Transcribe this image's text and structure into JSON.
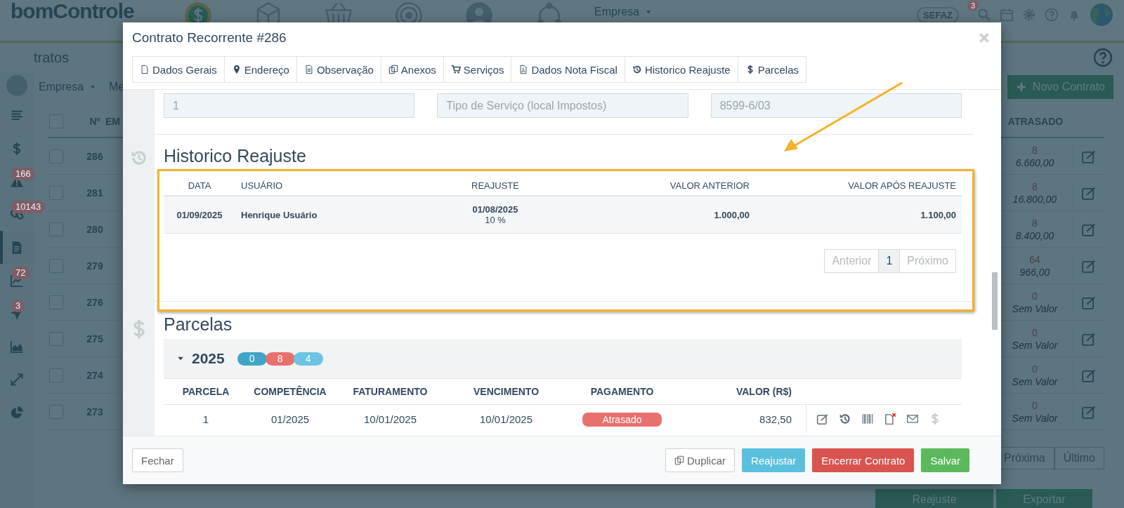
{
  "header": {
    "logo": "bomControle",
    "company_menu": "Empresa",
    "sefaz_logo": "SEFAZ",
    "notification_count": "3"
  },
  "page": {
    "title": "tratos",
    "filters": [
      "Empresa",
      "Me"
    ],
    "new_button": "Novo Contrato"
  },
  "sidebar": {
    "items": [
      {
        "kind": "menu",
        "selected": false
      },
      {
        "kind": "money",
        "selected": false
      },
      {
        "kind": "alert",
        "badge": "166",
        "selected": false
      },
      {
        "kind": "link",
        "badge": "10143",
        "selected": false
      },
      {
        "kind": "document",
        "selected": true
      },
      {
        "kind": "chart",
        "badge": "72",
        "selected": false
      },
      {
        "kind": "send",
        "badge": "3",
        "selected": false
      },
      {
        "kind": "area",
        "selected": false
      },
      {
        "kind": "expand",
        "selected": false
      },
      {
        "kind": "pie",
        "selected": false
      }
    ]
  },
  "contracts": {
    "all_checked": false,
    "columns": [
      "Nº",
      "EM",
      "ATRASADO"
    ],
    "rows": [
      {
        "checked": false,
        "number": "286",
        "overdue_count": "8",
        "overdue_value": "6.660,00"
      },
      {
        "checked": false,
        "number": "281",
        "overdue_count": "8",
        "overdue_value": "16.800,00"
      },
      {
        "checked": false,
        "number": "280",
        "overdue_count": "8",
        "overdue_value": "8.400,00"
      },
      {
        "checked": false,
        "number": "279",
        "overdue_count": "64",
        "overdue_value": "966,00"
      },
      {
        "checked": false,
        "number": "276",
        "overdue_count": "0",
        "overdue_value": "Sem Valor"
      },
      {
        "checked": false,
        "number": "275",
        "overdue_count": "0",
        "overdue_value": "Sem Valor"
      },
      {
        "checked": false,
        "number": "274",
        "overdue_count": "0",
        "overdue_value": "Sem Valor"
      },
      {
        "checked": false,
        "number": "273",
        "overdue_count": "0",
        "overdue_value": "Sem Valor"
      }
    ]
  },
  "pagination": [
    "Próxima",
    "Último"
  ],
  "actions": [
    "Reajuste",
    "Exportar"
  ],
  "modal": {
    "title": "Contrato Recorrente #286",
    "tabs": [
      {
        "label": "Dados Gerais",
        "selected": false
      },
      {
        "label": "Endereço",
        "selected": false
      },
      {
        "label": "Observação",
        "selected": false
      },
      {
        "label": "Anexos",
        "selected": false
      },
      {
        "label": "Serviços",
        "selected": false
      },
      {
        "label": "Dados Nota Fiscal",
        "selected": false
      },
      {
        "label": "Historico Reajuste",
        "selected": false
      },
      {
        "label": "Parcelas",
        "selected": false
      }
    ],
    "fields": [
      {
        "value": "1",
        "disabled": true
      },
      {
        "value": "Tipo de Serviço (local Impostos)",
        "disabled": true
      },
      {
        "value": "8599-6/03",
        "disabled": true
      }
    ],
    "history": {
      "title": "Historico Reajuste",
      "columns": [
        "DATA",
        "USUÁRIO",
        "REAJUSTE",
        "VALOR ANTERIOR",
        "VALOR APÓS REAJUSTE"
      ],
      "rows": [
        {
          "date": "01/09/2025",
          "user": "Henrique Usuário",
          "adjust_date": "01/08/2025",
          "adjust_rate": "10 %",
          "previous_value": "1.000,00",
          "new_value": "1.100,00"
        }
      ],
      "pagination": {
        "previous": "Anterior",
        "page": "1",
        "next": "Próximo"
      }
    },
    "installments": {
      "title": "Parcelas",
      "groups": [
        {
          "year": "2025",
          "expanded": true,
          "counts": [
            {
              "value": "0",
              "color": "#3fa6c7"
            },
            {
              "value": "8",
              "color": "#e8716d"
            },
            {
              "value": "4",
              "color": "#6cc3e3"
            }
          ]
        }
      ],
      "columns": [
        "PARCELA",
        "COMPETÊNCIA",
        "FATURAMENTO",
        "VENCIMENTO",
        "PAGAMENTO",
        "VALOR (R$)"
      ],
      "rows": [
        {
          "number": "1",
          "period": "01/2025",
          "billing": "10/01/2025",
          "due": "10/01/2025",
          "status": "Atrasado",
          "value": "832,50"
        }
      ]
    },
    "footer": [
      {
        "label": "Fechar",
        "kind": "default"
      },
      {
        "label": "Duplicar",
        "kind": "copy"
      },
      {
        "label": "Reajustar",
        "kind": "info"
      },
      {
        "label": "Encerrar Contrato",
        "kind": "danger"
      },
      {
        "label": "Salvar",
        "kind": "success"
      }
    ]
  },
  "annotations": {
    "highlight_box": true,
    "arrow": true
  }
}
